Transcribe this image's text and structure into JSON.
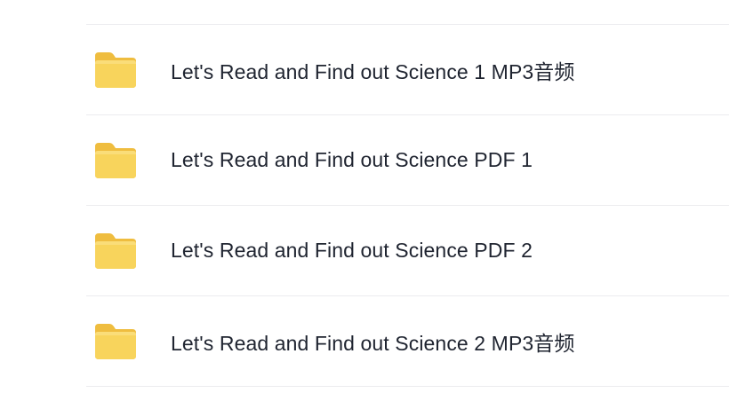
{
  "folder_list": {
    "items": [
      {
        "label": "Let's Read and Find out Science 1 MP3音频",
        "icon": "folder-icon"
      },
      {
        "label": "Let's Read and Find out Science PDF 1",
        "icon": "folder-icon"
      },
      {
        "label": "Let's Read and Find out Science PDF 2",
        "icon": "folder-icon"
      },
      {
        "label": "Let's Read and Find out Science 2 MP3音频",
        "icon": "folder-icon"
      }
    ]
  },
  "colors": {
    "folder_body": "#f8d45c",
    "folder_back": "#efbd3f",
    "divider": "#ececef",
    "text": "#1f2430"
  }
}
